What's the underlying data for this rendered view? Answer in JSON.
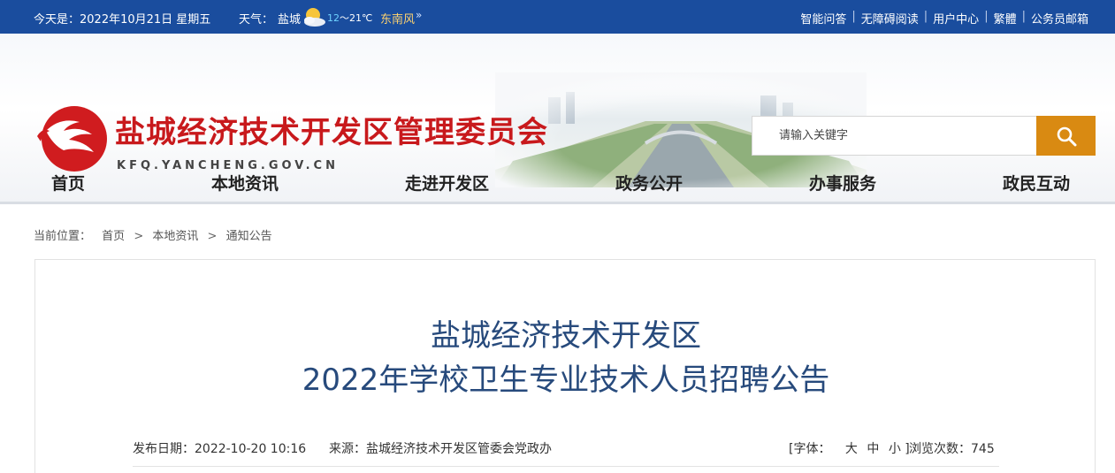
{
  "topbar": {
    "date_text": "今天是：2022年10月21日 星期五",
    "weather_label": "天气：",
    "city": "盐城",
    "temp_low": "12",
    "temp_high": "～21℃",
    "wind": "东南风",
    "more_glyph": "»",
    "links": [
      "智能问答",
      "无障碍阅读",
      "用户中心",
      "繁體",
      "公务员邮箱"
    ],
    "separator": "|"
  },
  "header": {
    "site_title": "盐城经济技术开发区管理委员会",
    "site_domain": "KFQ.YANCHENG.GOV.CN",
    "search_placeholder": "请输入关键字"
  },
  "nav": {
    "items": [
      "首页",
      "本地资讯",
      "走进开发区",
      "政务公开",
      "办事服务",
      "政民互动"
    ]
  },
  "breadcrumb": {
    "label": "当前位置：",
    "items": [
      "首页",
      "本地资讯",
      "通知公告"
    ],
    "sep": ">"
  },
  "article": {
    "title_line1": "盐城经济技术开发区",
    "title_line2": "2022年学校卫生专业技术人员招聘公告",
    "publish_date": "发布日期：2022-10-20 10:16",
    "source": "来源：盐城经济技术开发区管委会党政办",
    "font_label": "[字体：",
    "font_large": "大",
    "font_medium": "中",
    "font_small": "小 ]",
    "views": "浏览次数：745"
  },
  "colors": {
    "topbar_bg": "#1a4d9e",
    "title_red": "#c8191c",
    "search_button": "#d98a12",
    "article_title": "#274a7c"
  }
}
